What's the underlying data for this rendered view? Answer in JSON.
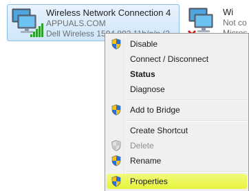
{
  "adapters": [
    {
      "name": "Wireless Network Connection 4",
      "network": "APPUALS.COM",
      "device": "Dell Wireless 1504 802.11b/g/n (2..."
    },
    {
      "name": "Wi",
      "network": "Not co",
      "device": "Micros"
    }
  ],
  "context_menu": {
    "items": [
      {
        "label": "Disable",
        "shield": true,
        "bold": false,
        "enabled": true
      },
      {
        "label": "Connect / Disconnect",
        "shield": false,
        "bold": false,
        "enabled": true
      },
      {
        "label": "Status",
        "shield": false,
        "bold": true,
        "enabled": true
      },
      {
        "label": "Diagnose",
        "shield": false,
        "bold": false,
        "enabled": true
      },
      {
        "label": "Add to Bridge",
        "shield": true,
        "bold": false,
        "enabled": true
      },
      {
        "label": "Create Shortcut",
        "shield": false,
        "bold": false,
        "enabled": true
      },
      {
        "label": "Delete",
        "shield": true,
        "bold": false,
        "enabled": false
      },
      {
        "label": "Rename",
        "shield": true,
        "bold": false,
        "enabled": true
      },
      {
        "label": "Properties",
        "shield": true,
        "bold": false,
        "enabled": true,
        "highlighted": true
      }
    ]
  },
  "colors": {
    "highlight": "#e7f43c",
    "selection": "#cfe6fb",
    "signal_green": "#2f9e2f",
    "error_red": "#d02020"
  }
}
